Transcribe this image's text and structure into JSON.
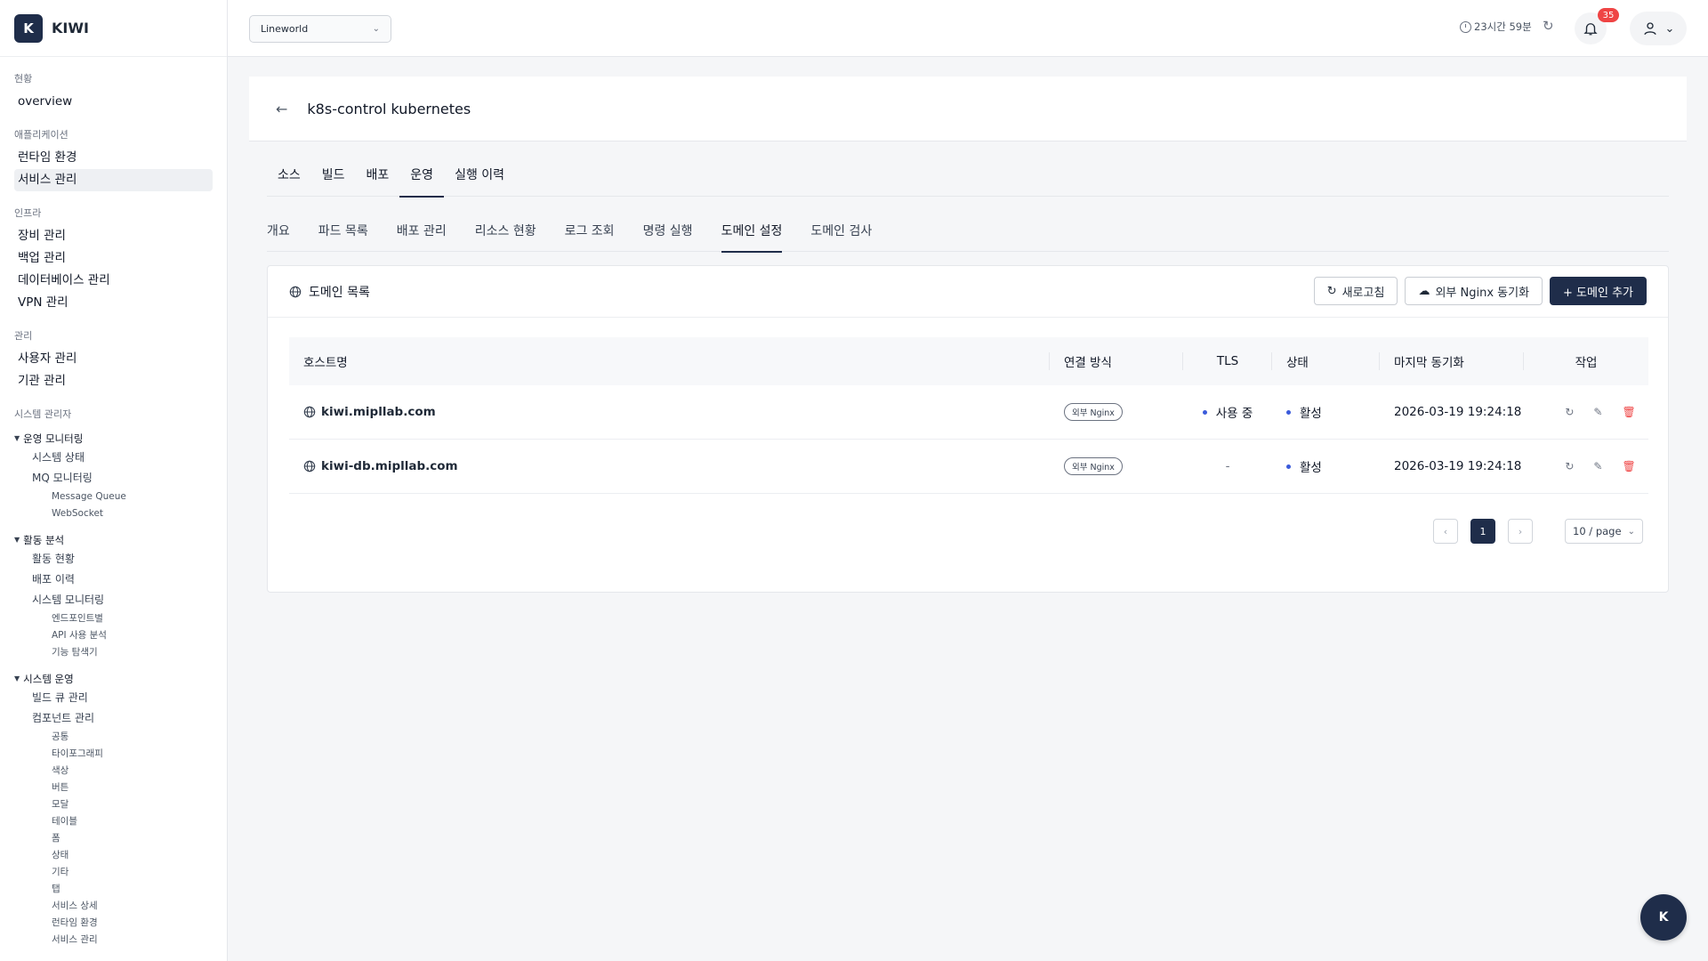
{
  "brand": {
    "mark": "K",
    "name": "KIWI"
  },
  "sidebar": {
    "sections": [
      {
        "label": "현황",
        "items": [
          "overview"
        ]
      },
      {
        "label": "애플리케이션",
        "items": [
          "런타임 환경",
          "서비스 관리"
        ]
      },
      {
        "label": "인프라",
        "items": [
          "장비 관리",
          "백업 관리",
          "데이터베이스 관리",
          "VPN 관리"
        ]
      },
      {
        "label": "관리",
        "items": [
          "사용자 관리",
          "기관 관리"
        ]
      }
    ],
    "active_item": "서비스 관리",
    "admin_label": "시스템 관리자",
    "groups": [
      {
        "label": "운영 모니터링",
        "subs": [
          {
            "label": "시스템 상태",
            "children": []
          },
          {
            "label": "MQ 모니터링",
            "children": [
              "Message Queue",
              "WebSocket"
            ]
          }
        ]
      },
      {
        "label": "활동 분석",
        "subs": [
          {
            "label": "활동 현황",
            "children": []
          },
          {
            "label": "배포 이력",
            "children": []
          },
          {
            "label": "시스템 모니터링",
            "children": [
              "엔드포인트별",
              "API 사용 분석",
              "기능 탐색기"
            ]
          }
        ]
      },
      {
        "label": "시스템 운영",
        "subs": [
          {
            "label": "빌드 큐 관리",
            "children": []
          },
          {
            "label": "컴포넌트 관리",
            "children": [
              "공통",
              "타이포그래피",
              "색상",
              "버튼",
              "모달",
              "테이블",
              "폼",
              "상태",
              "기타",
              "탭",
              "서비스 상세",
              "런타임 환경",
              "서비스 관리"
            ]
          }
        ]
      }
    ]
  },
  "topbar": {
    "org_select": "Lineworld",
    "session_time": "23시간 59분",
    "notification_count": "35"
  },
  "page": {
    "title": "k8s-control kubernetes"
  },
  "main_tabs": [
    "소스",
    "빌드",
    "배포",
    "운영",
    "실행 이력"
  ],
  "main_tab_active": 3,
  "sub_tabs": [
    "개요",
    "파드 목록",
    "배포 관리",
    "리소스 현황",
    "로그 조회",
    "명령 실행",
    "도메인 설정",
    "도메인 검사"
  ],
  "sub_tab_active": 6,
  "domain_card": {
    "title": "도메인 목록",
    "refresh_label": "새로고침",
    "sync_label": "외부 Nginx 동기화",
    "add_label": "+ 도메인 추가"
  },
  "table": {
    "columns": [
      "호스트명",
      "연결 방식",
      "TLS",
      "상태",
      "마지막 동기화",
      "작업"
    ],
    "rows": [
      {
        "host": "kiwi.mipllab.com",
        "method": "외부 Nginx",
        "tls": "사용 중",
        "tls_on": true,
        "status": "활성",
        "synced": "2026-03-19 19:24:18"
      },
      {
        "host": "kiwi-db.mipllab.com",
        "method": "외부 Nginx",
        "tls": "-",
        "tls_on": false,
        "status": "활성",
        "synced": "2026-03-19 19:24:18"
      }
    ]
  },
  "pagination": {
    "current": "1",
    "page_size": "10 / page"
  },
  "fab": {
    "label": "K"
  },
  "colors": {
    "primary": "#1f2d4a",
    "dot": "#3b5bdb",
    "danger": "#ef4444"
  }
}
